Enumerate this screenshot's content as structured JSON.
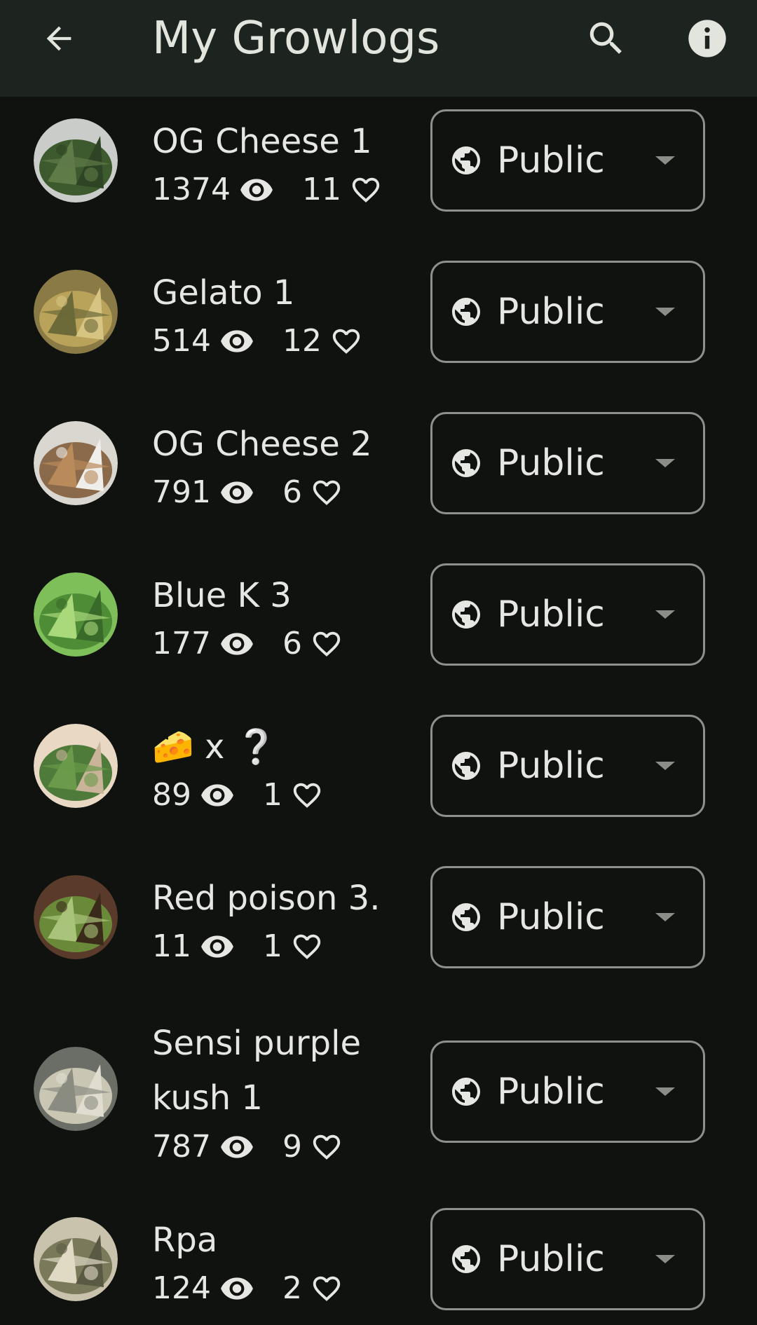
{
  "appbar": {
    "title": "My Growlogs",
    "back_icon": "arrow-back-icon",
    "search_icon": "search-icon",
    "info_icon": "info-icon"
  },
  "colors": {
    "background": "#0f120f",
    "appbar": "#1d231e",
    "text": "#e6e7e3",
    "outline": "#8d918b",
    "caret": "#8a8d88"
  },
  "growlogs": [
    {
      "name": "OG Cheese 1",
      "views": "1374",
      "likes": "11",
      "visibility": "Public"
    },
    {
      "name": "Gelato 1",
      "views": "514",
      "likes": "12",
      "visibility": "Public"
    },
    {
      "name": "OG Cheese 2",
      "views": "791",
      "likes": "6",
      "visibility": "Public"
    },
    {
      "name": "Blue K 3",
      "views": "177",
      "likes": "6",
      "visibility": "Public"
    },
    {
      "name": "🧀 x ❔",
      "views": "89",
      "likes": "1",
      "visibility": "Public"
    },
    {
      "name": "Red poison 3.",
      "views": "11",
      "likes": "1",
      "visibility": "Public"
    },
    {
      "name": "Sensi purple kush 1",
      "views": "787",
      "likes": "9",
      "visibility": "Public"
    },
    {
      "name": "Rpa",
      "views": "124",
      "likes": "2",
      "visibility": "Public"
    }
  ]
}
